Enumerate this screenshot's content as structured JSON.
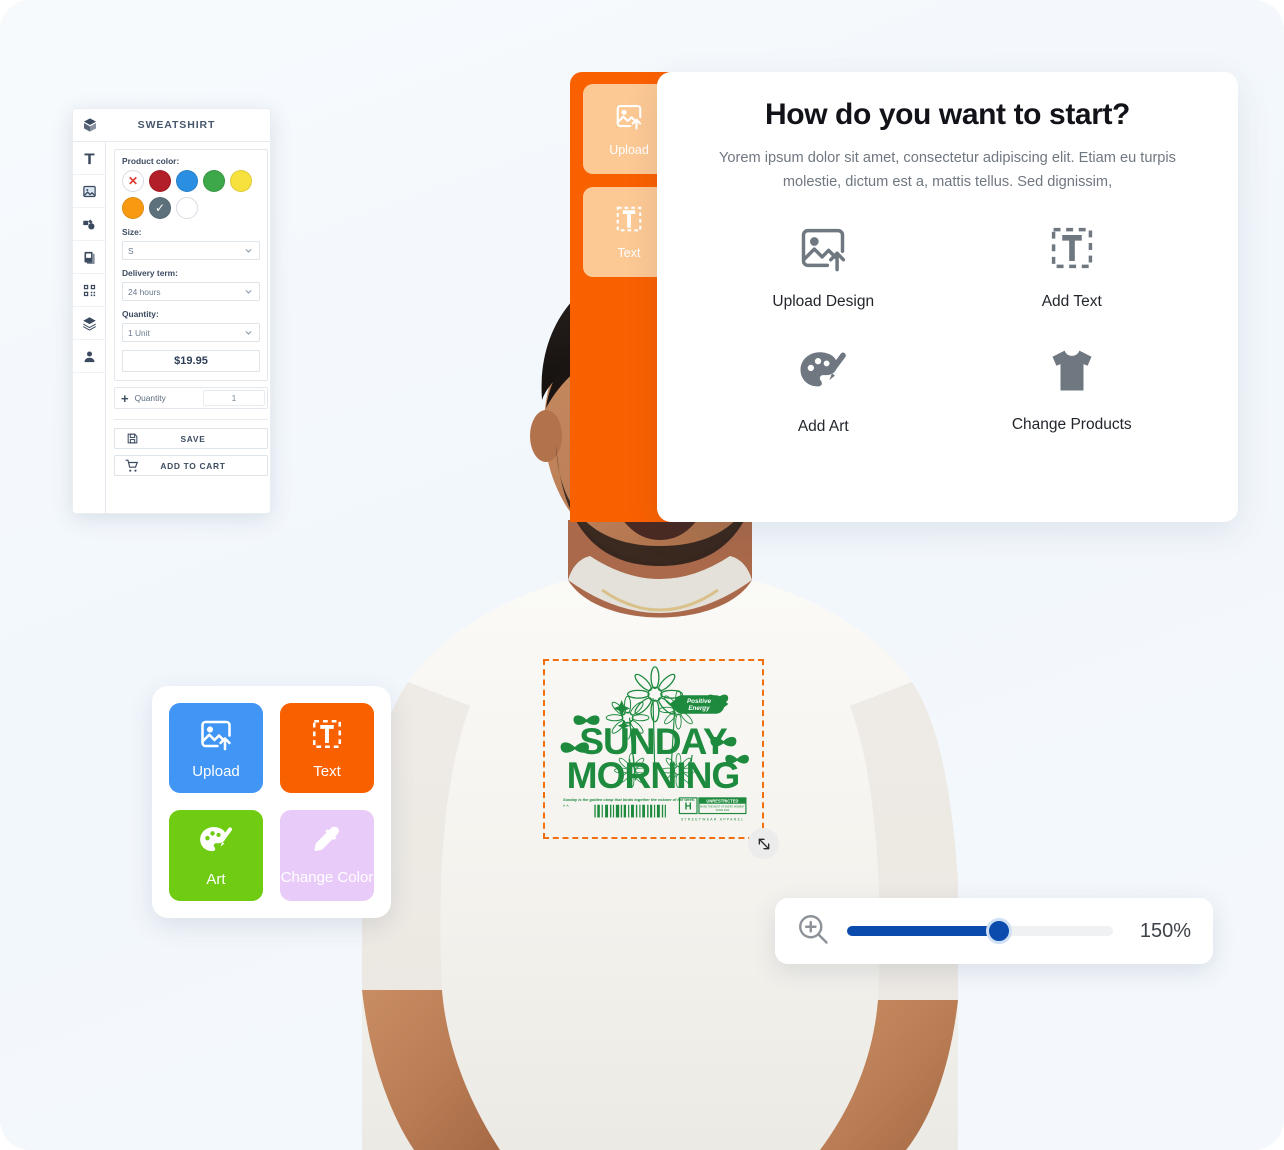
{
  "product_panel": {
    "title": "SWEATSHIRT",
    "box_icon": "box-icon",
    "tools": [
      {
        "name": "text-tool",
        "icon": "text-icon"
      },
      {
        "name": "image-tool",
        "icon": "image-icon"
      },
      {
        "name": "art-tool",
        "icon": "palette-icon"
      },
      {
        "name": "gallery-tool",
        "icon": "book-icon"
      },
      {
        "name": "qr-tool",
        "icon": "qr-code-icon"
      },
      {
        "name": "layers-tool",
        "icon": "layers-icon"
      },
      {
        "name": "account-tool",
        "icon": "person-icon"
      }
    ],
    "color_label": "Product color:",
    "colors": [
      {
        "name": "no-color",
        "hex": "#ffffff",
        "state": "none"
      },
      {
        "name": "dark-red",
        "hex": "#b21f28",
        "state": "normal"
      },
      {
        "name": "blue",
        "hex": "#2a8fe0",
        "state": "normal"
      },
      {
        "name": "green",
        "hex": "#3da84a",
        "state": "normal"
      },
      {
        "name": "yellow",
        "hex": "#f6e13d",
        "state": "normal"
      },
      {
        "name": "orange",
        "hex": "#f79a12",
        "state": "normal"
      },
      {
        "name": "slate",
        "hex": "#5c717c",
        "state": "selected"
      },
      {
        "name": "white",
        "hex": "#ffffff",
        "state": "normal"
      }
    ],
    "size_label": "Size:",
    "size_value": "S",
    "delivery_label": "Delivery term:",
    "delivery_value": "24 hours",
    "quantity_label": "Quantity:",
    "quantity_value": "1 Unit",
    "price": "$19.95",
    "qty_row_label": "Quantity",
    "qty_row_value": "1",
    "save_label": "SAVE",
    "cart_label": "ADD TO CART"
  },
  "orange_rail": {
    "bg": "#f96000",
    "tiles": [
      {
        "label": "Upload",
        "icon": "upload-image-icon"
      },
      {
        "label": "Text",
        "icon": "add-text-icon"
      }
    ]
  },
  "start_card": {
    "title": "How do you want to start?",
    "subtitle": "Yorem ipsum dolor sit amet, consectetur adipiscing elit. Etiam eu turpis molestie, dictum est a, mattis tellus. Sed dignissim,",
    "options": [
      {
        "label": "Upload Design",
        "icon": "upload-image-icon"
      },
      {
        "label": "Add Text",
        "icon": "add-text-icon"
      },
      {
        "label": "Add Art",
        "icon": "palette-icon"
      },
      {
        "label": "Change Products",
        "icon": "tshirt-icon"
      }
    ]
  },
  "tool_card": {
    "tiles": [
      {
        "label": "Upload",
        "icon": "upload-image-icon",
        "color": "#4095f5"
      },
      {
        "label": "Text",
        "icon": "add-text-icon",
        "color": "#f96000"
      },
      {
        "label": "Art",
        "icon": "palette-icon",
        "color": "#6fcc12"
      },
      {
        "label": "Change Color",
        "icon": "eyedropper-icon",
        "color": "#e8cbf8"
      }
    ]
  },
  "zoom_bar": {
    "icon": "zoom-in-icon",
    "value": "150%",
    "percent": 57
  },
  "design": {
    "headline_top": "SUNDAY",
    "headline_bottom": "MORNING",
    "badge": "Positive Energy",
    "tagline": "Sunday is the golden clasp that binds together the volume of the week.",
    "stamp_letter": "H",
    "stamp_title": "UNRESTRICTED",
    "stamp_sub": "STREETWEAR APPAREL",
    "accent": "#1d8a3e",
    "selection_color": "#f07010",
    "resize_handle_icon": "resize-diagonal-icon"
  }
}
